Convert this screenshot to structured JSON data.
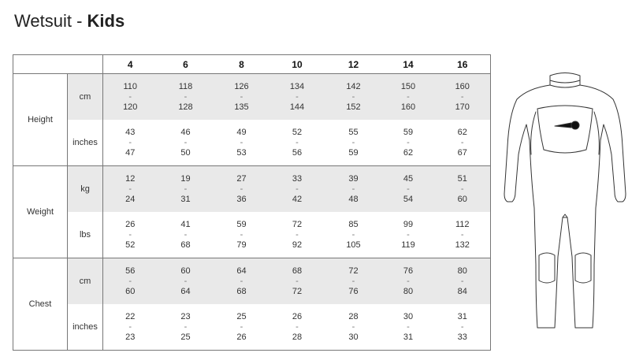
{
  "title": {
    "prefix": "Wetsuit - ",
    "bold": "Kids"
  },
  "table": {
    "sizes": [
      "4",
      "6",
      "8",
      "10",
      "12",
      "14",
      "16"
    ],
    "groups": [
      {
        "label": "Height",
        "rows": [
          {
            "unit": "cm",
            "values": [
              [
                "110",
                "120"
              ],
              [
                "118",
                "128"
              ],
              [
                "126",
                "135"
              ],
              [
                "134",
                "144"
              ],
              [
                "142",
                "152"
              ],
              [
                "150",
                "160"
              ],
              [
                "160",
                "170"
              ]
            ]
          },
          {
            "unit": "inches",
            "values": [
              [
                "43",
                "47"
              ],
              [
                "46",
                "50"
              ],
              [
                "49",
                "53"
              ],
              [
                "52",
                "56"
              ],
              [
                "55",
                "59"
              ],
              [
                "59",
                "62"
              ],
              [
                "62",
                "67"
              ]
            ]
          }
        ]
      },
      {
        "label": "Weight",
        "rows": [
          {
            "unit": "kg",
            "values": [
              [
                "12",
                "24"
              ],
              [
                "19",
                "31"
              ],
              [
                "27",
                "36"
              ],
              [
                "33",
                "42"
              ],
              [
                "39",
                "48"
              ],
              [
                "45",
                "54"
              ],
              [
                "51",
                "60"
              ]
            ]
          },
          {
            "unit": "lbs",
            "values": [
              [
                "26",
                "52"
              ],
              [
                "41",
                "68"
              ],
              [
                "59",
                "79"
              ],
              [
                "72",
                "92"
              ],
              [
                "85",
                "105"
              ],
              [
                "99",
                "119"
              ],
              [
                "112",
                "132"
              ]
            ]
          }
        ]
      },
      {
        "label": "Chest",
        "rows": [
          {
            "unit": "cm",
            "values": [
              [
                "56",
                "60"
              ],
              [
                "60",
                "64"
              ],
              [
                "64",
                "68"
              ],
              [
                "68",
                "72"
              ],
              [
                "72",
                "76"
              ],
              [
                "76",
                "80"
              ],
              [
                "80",
                "84"
              ]
            ]
          },
          {
            "unit": "inches",
            "values": [
              [
                "22",
                "23"
              ],
              [
                "23",
                "25"
              ],
              [
                "25",
                "26"
              ],
              [
                "26",
                "28"
              ],
              [
                "28",
                "30"
              ],
              [
                "30",
                "31"
              ],
              [
                "31",
                "33"
              ]
            ]
          }
        ]
      }
    ],
    "range_separator": "-"
  },
  "illustration": {
    "icon": "wetsuit-icon",
    "line_color": "#333333"
  }
}
